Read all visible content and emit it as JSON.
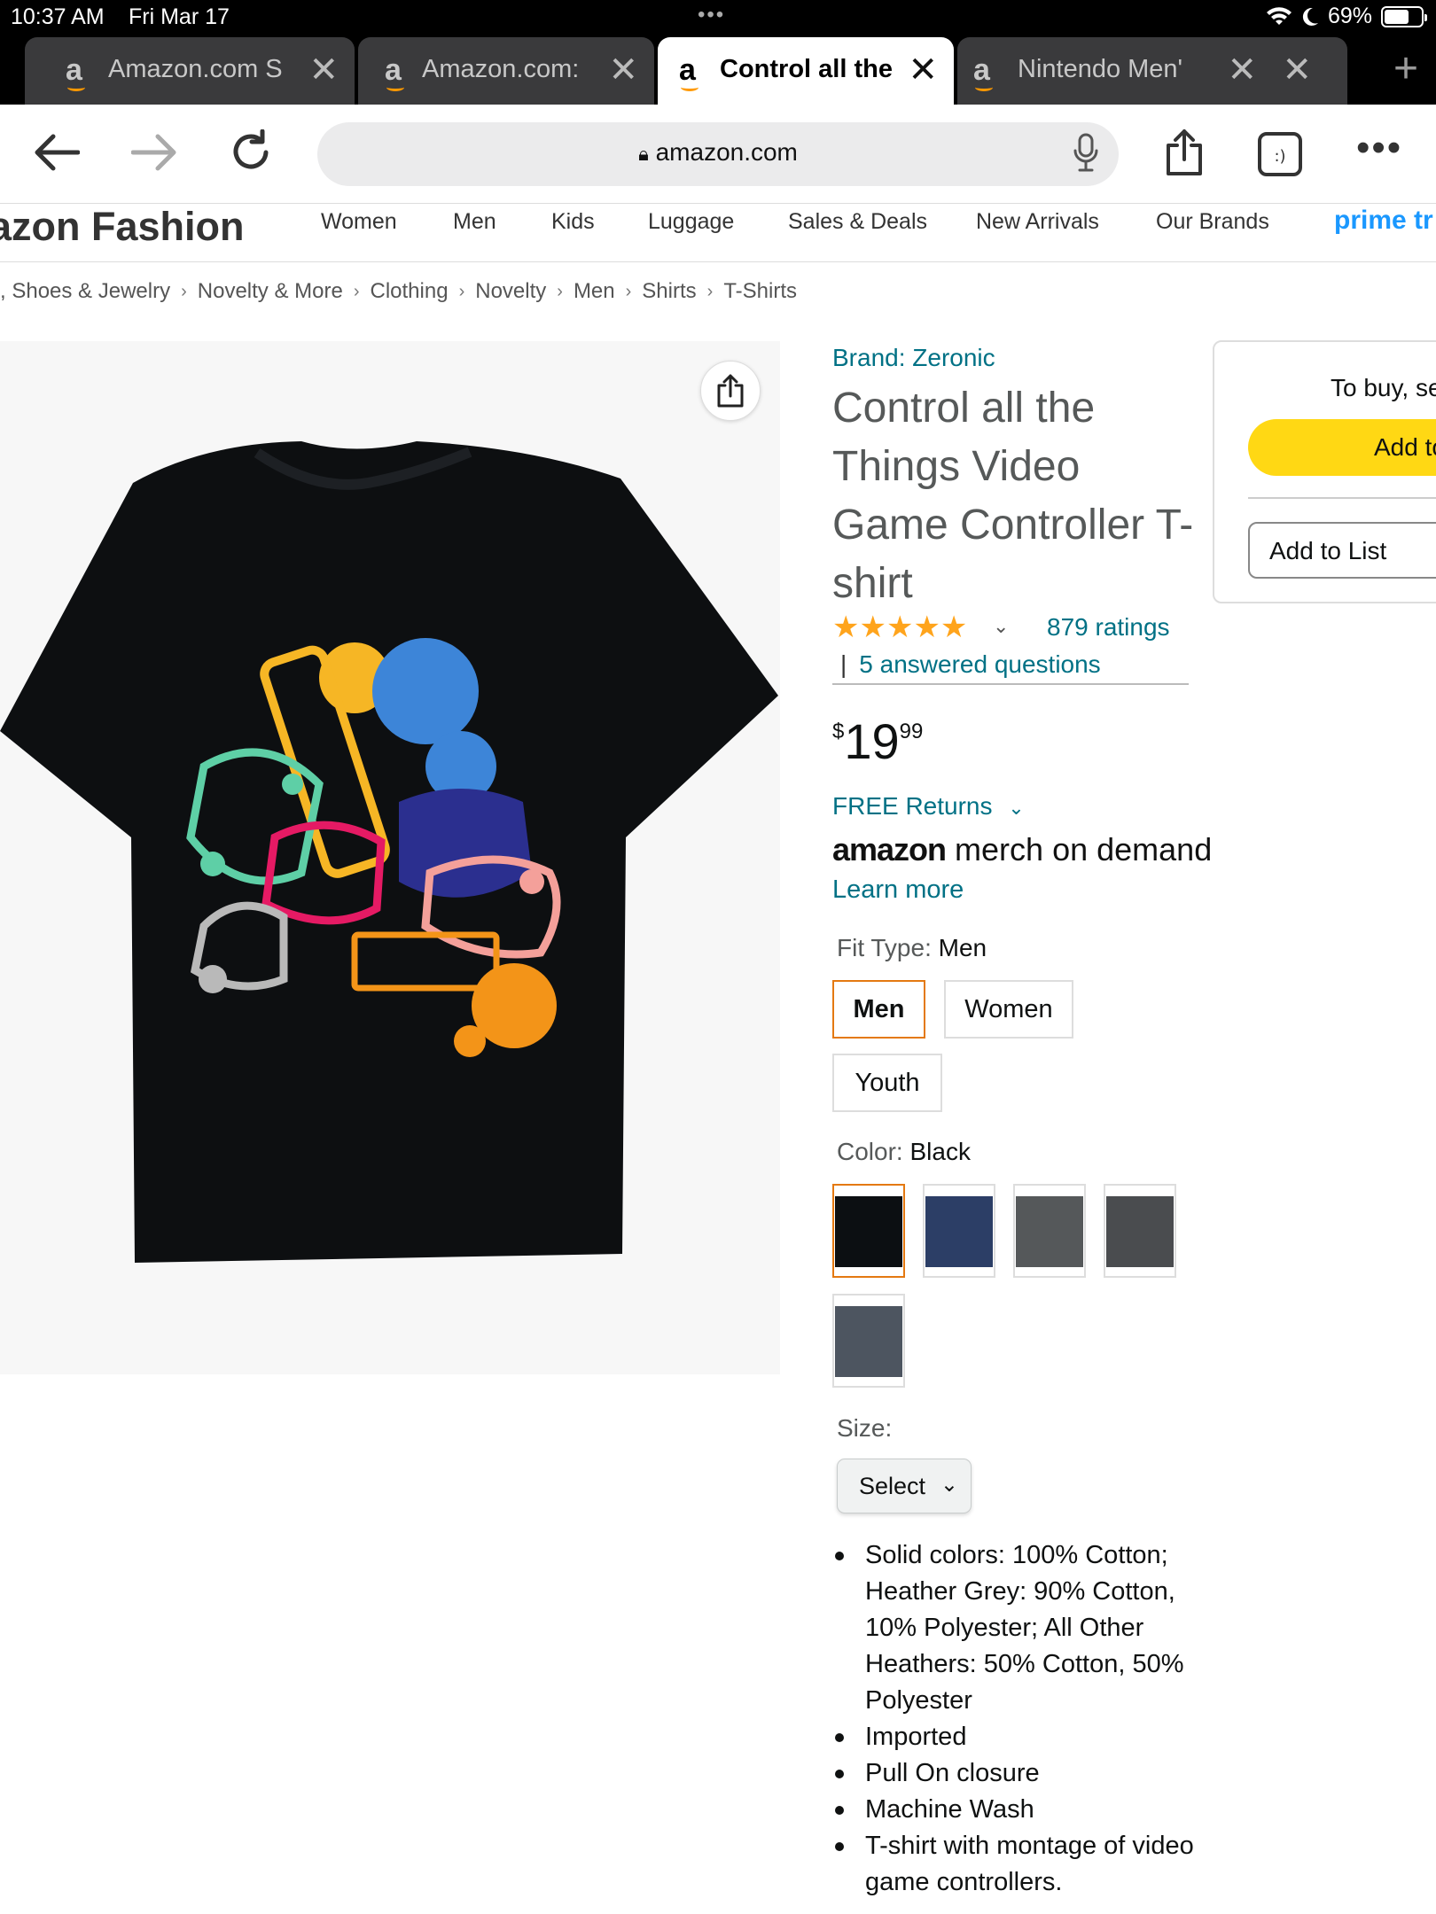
{
  "status": {
    "time": "10:37 AM",
    "date": "Fri Mar 17",
    "battery": "69%"
  },
  "tabs": [
    {
      "title": "Amazon.com S",
      "active": false
    },
    {
      "title": "Amazon.com:",
      "active": false
    },
    {
      "title": "Control all the",
      "active": true
    },
    {
      "title": "Nintendo Men'",
      "active": false
    }
  ],
  "toolbar": {
    "url": "amazon.com"
  },
  "fashion_nav": {
    "brand": "azon Fashion",
    "items": [
      "Women",
      "Men",
      "Kids",
      "Luggage",
      "Sales & Deals",
      "New Arrivals",
      "Our Brands"
    ],
    "prime": "prime tr"
  },
  "breadcrumb": [
    ", Shoes & Jewelry",
    "Novelty & More",
    "Clothing",
    "Novelty",
    "Men",
    "Shirts",
    "T-Shirts"
  ],
  "product": {
    "brand": "Brand: Zeronic",
    "title": "Control all the Things Video Game Controller T-shirt",
    "stars": "★★★★★",
    "ratings": "879 ratings",
    "answered": "5 answered questions",
    "price_symbol": "$",
    "price_whole": "19",
    "price_fraction": "99",
    "returns": "FREE Returns",
    "merch_brand": "amazon",
    "merch_suffix": " merch on demand",
    "learn_more": "Learn more",
    "fit_label": "Fit Type: ",
    "fit_value": "Men",
    "fit_options": [
      "Men",
      "Women",
      "Youth"
    ],
    "color_label": "Color: ",
    "color_value": "Black",
    "colors": [
      "#0c0f12",
      "#2c3e66",
      "#55585a",
      "#4a4c4f",
      "#4d5560"
    ],
    "size_label": "Size:",
    "size_select": "Select",
    "bullets": [
      "Solid colors: 100% Cotton; Heather Grey: 90% Cotton, 10% Polyester; All Other Heathers: 50% Cotton, 50% Polyester",
      "Imported",
      "Pull On closure",
      "Machine Wash",
      "T-shirt with montage of video game controllers."
    ]
  },
  "buybox": {
    "to_buy": "To buy, se",
    "add_to_cart": "Add to",
    "add_to_list": "Add to List"
  }
}
